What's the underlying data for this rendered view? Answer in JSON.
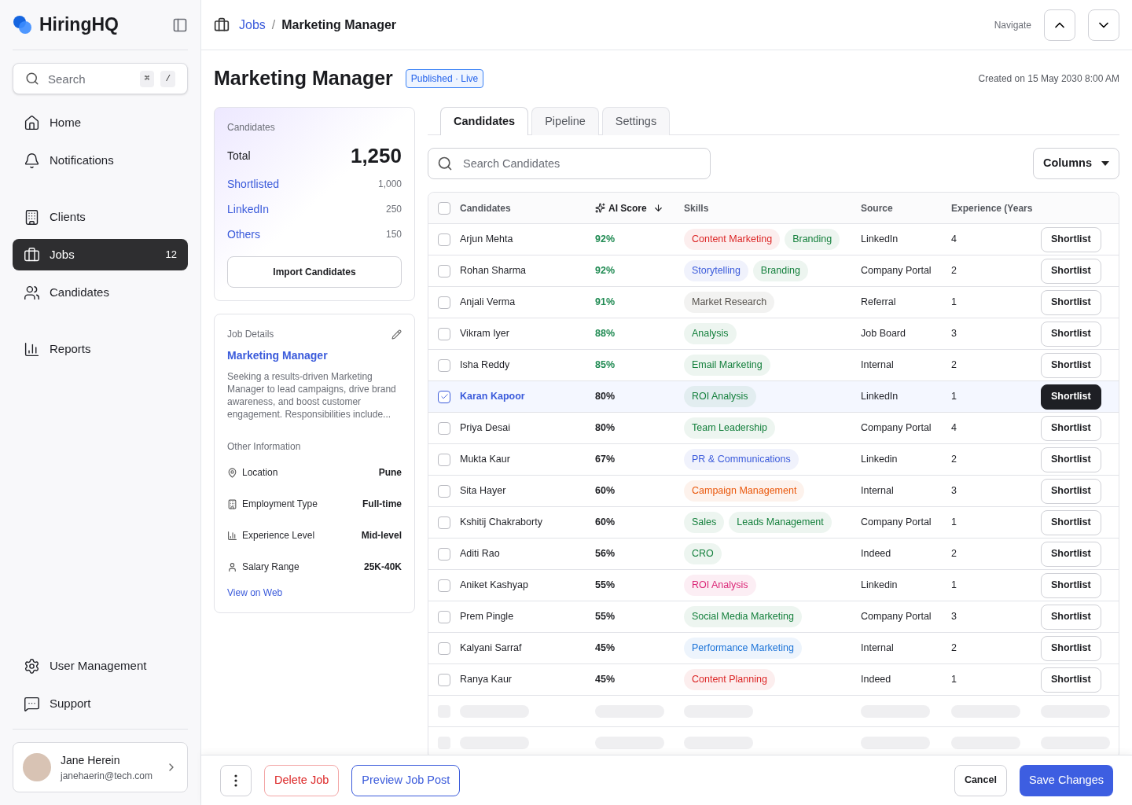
{
  "brand": {
    "name": "HiringHQ"
  },
  "sidebar": {
    "search": {
      "placeholder": "Search",
      "keys": [
        "⌘",
        "/"
      ]
    },
    "groups": [
      [
        {
          "label": "Home",
          "selected": false
        },
        {
          "label": "Notifications",
          "selected": false
        }
      ],
      [
        {
          "label": "Clients",
          "selected": false
        },
        {
          "label": "Jobs",
          "selected": true,
          "count": "12"
        },
        {
          "label": "Candidates",
          "selected": false
        }
      ],
      [
        {
          "label": "Reports",
          "selected": false
        }
      ]
    ],
    "bottom": [
      {
        "label": "User Management"
      },
      {
        "label": "Support"
      }
    ],
    "user": {
      "name": "Jane Herein",
      "email": "janehaerin@tech.com"
    }
  },
  "breadcrumb": [
    "Jobs",
    "/",
    "Marketing Manager"
  ],
  "navigate": {
    "label": "Navigate"
  },
  "page": {
    "title": "Marketing Manager",
    "status": "Published · Live",
    "created": "Created on 15 May 2030 8:00 AM"
  },
  "summary": {
    "heading": "Candidates",
    "total_label": "Total",
    "total": "1,250",
    "rows": [
      {
        "label": "Shortlisted",
        "value": "1,000"
      },
      {
        "label": "LinkedIn",
        "value": "250"
      },
      {
        "label": "Others",
        "value": "150"
      }
    ],
    "button": "Import Candidates"
  },
  "job_details": {
    "heading": "Job Details",
    "title": "Marketing Manager",
    "description": "Seeking a results-driven Marketing Manager to lead campaigns, drive brand awareness, and boost customer engagement. Responsibilities include...",
    "other_heading": "Other Information",
    "info": [
      {
        "label": "Location",
        "value": "Pune"
      },
      {
        "label": "Employment Type",
        "value": "Full-time"
      },
      {
        "label": "Experience Level",
        "value": "Mid-level"
      },
      {
        "label": "Salary Range",
        "value": "25K-40K"
      }
    ],
    "link": "View on Web"
  },
  "tabs": [
    {
      "label": "Candidates",
      "selected": true
    },
    {
      "label": "Pipeline",
      "selected": false
    },
    {
      "label": "Settings",
      "selected": false
    }
  ],
  "table_search": {
    "placeholder": "Search Candidates"
  },
  "columns_button": "Columns",
  "table": {
    "all_selected": false,
    "columns": [
      "Candidates",
      "AI Score",
      "Skills",
      "Source",
      "Experience (Years"
    ],
    "rows": [
      {
        "name": "Arjun Mehta",
        "score": "92%",
        "high": true,
        "skills": [
          {
            "label": "Content Marketing",
            "color": "#dc2626"
          },
          {
            "label": "Branding",
            "color": "#15803d"
          }
        ],
        "source": "LinkedIn",
        "exp": "4",
        "selected": false,
        "action": "Shortlist"
      },
      {
        "name": "Rohan Sharma",
        "score": "92%",
        "high": true,
        "skills": [
          {
            "label": "Storytelling",
            "color": "#3b5bdb"
          },
          {
            "label": "Branding",
            "color": "#15803d"
          }
        ],
        "source": "Company Portal",
        "exp": "2",
        "selected": false,
        "action": "Shortlist"
      },
      {
        "name": "Anjali Verma",
        "score": "91%",
        "high": true,
        "skills": [
          {
            "label": "Market Research",
            "color": "#57534e"
          }
        ],
        "source": "Referral",
        "exp": "1",
        "selected": false,
        "action": "Shortlist"
      },
      {
        "name": "Vikram Iyer",
        "score": "88%",
        "high": true,
        "skills": [
          {
            "label": "Analysis",
            "color": "#15803d"
          }
        ],
        "source": "Job Board",
        "exp": "3",
        "selected": false,
        "action": "Shortlist"
      },
      {
        "name": "Isha Reddy",
        "score": "85%",
        "high": true,
        "skills": [
          {
            "label": "Email Marketing",
            "color": "#15803d"
          }
        ],
        "source": "Internal",
        "exp": "2",
        "selected": false,
        "action": "Shortlist"
      },
      {
        "name": "Karan Kapoor",
        "score": "80%",
        "high": false,
        "skills": [
          {
            "label": "ROI Analysis",
            "color": "#15803d"
          }
        ],
        "source": "LinkedIn",
        "exp": "1",
        "selected": true,
        "action": "Shortlist"
      },
      {
        "name": "Priya Desai",
        "score": "80%",
        "high": false,
        "skills": [
          {
            "label": "Team Leadership",
            "color": "#15803d"
          }
        ],
        "source": "Company Portal",
        "exp": "4",
        "selected": false,
        "action": "Shortlist"
      },
      {
        "name": "Mukta Kaur",
        "score": "67%",
        "high": false,
        "skills": [
          {
            "label": "PR & Communications",
            "color": "#3b5bdb"
          }
        ],
        "source": "Linkedin",
        "exp": "2",
        "selected": false,
        "action": "Shortlist"
      },
      {
        "name": "Sita Hayer",
        "score": "60%",
        "high": false,
        "skills": [
          {
            "label": "Campaign Management",
            "color": "#ea580c"
          }
        ],
        "source": "Internal",
        "exp": "3",
        "selected": false,
        "action": "Shortlist"
      },
      {
        "name": "Kshitij Chakraborty",
        "score": "60%",
        "high": false,
        "skills": [
          {
            "label": "Sales",
            "color": "#15803d"
          },
          {
            "label": "Leads Management",
            "color": "#15803d"
          }
        ],
        "source": "Company Portal",
        "exp": "1",
        "selected": false,
        "action": "Shortlist"
      },
      {
        "name": "Aditi Rao",
        "score": "56%",
        "high": false,
        "skills": [
          {
            "label": "CRO",
            "color": "#15803d"
          }
        ],
        "source": "Indeed",
        "exp": "2",
        "selected": false,
        "action": "Shortlist"
      },
      {
        "name": "Aniket Kashyap",
        "score": "55%",
        "high": false,
        "skills": [
          {
            "label": "ROI Analysis",
            "color": "#db2777"
          }
        ],
        "source": "Linkedin",
        "exp": "1",
        "selected": false,
        "action": "Shortlist"
      },
      {
        "name": "Prem Pingle",
        "score": "55%",
        "high": false,
        "skills": [
          {
            "label": "Social Media Marketing",
            "color": "#15803d"
          }
        ],
        "source": "Company Portal",
        "exp": "3",
        "selected": false,
        "action": "Shortlist"
      },
      {
        "name": "Kalyani Sarraf",
        "score": "45%",
        "high": false,
        "skills": [
          {
            "label": "Performance Marketing",
            "color": "#1d74d8"
          }
        ],
        "source": "Internal",
        "exp": "2",
        "selected": false,
        "action": "Shortlist"
      },
      {
        "name": "Ranya Kaur",
        "score": "45%",
        "high": false,
        "skills": [
          {
            "label": "Content Planning",
            "color": "#dc2626"
          }
        ],
        "source": "Indeed",
        "exp": "1",
        "selected": false,
        "action": "Shortlist"
      }
    ]
  },
  "footer": {
    "delete": "Delete Job",
    "preview": "Preview Job Post",
    "cancel": "Cancel",
    "save": "Save Changes"
  }
}
